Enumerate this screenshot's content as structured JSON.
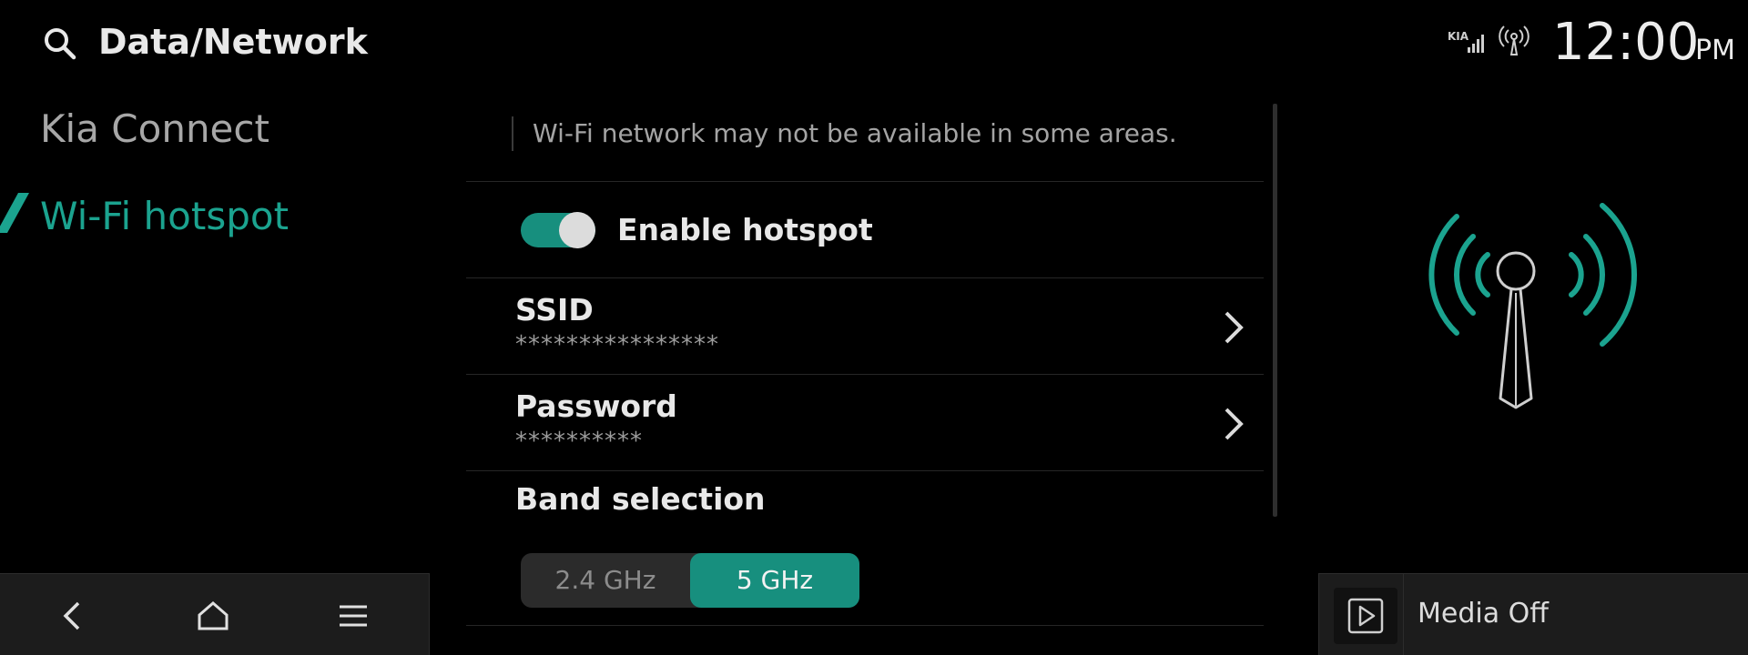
{
  "header": {
    "title": "Data/Network",
    "time": "12:00",
    "ampm": "PM",
    "status_icons": [
      "kia-signal-icon",
      "hotspot-broadcast-icon"
    ]
  },
  "sidebar": {
    "items": [
      {
        "label": "Kia Connect",
        "selected": false
      },
      {
        "label": "Wi-Fi hotspot",
        "selected": true
      }
    ]
  },
  "content": {
    "notice": "Wi-Fi network may not be available in some areas.",
    "hotspot": {
      "label": "Enable hotspot",
      "enabled": true
    },
    "ssid": {
      "label": "SSID",
      "value": "****************"
    },
    "password": {
      "label": "Password",
      "value": "**********"
    },
    "band": {
      "label": "Band selection",
      "options": [
        "2.4 GHz",
        "5 GHz"
      ],
      "selected": "5 GHz"
    }
  },
  "bottom_nav": {
    "icons": [
      "back-icon",
      "home-icon",
      "menu-icon"
    ]
  },
  "media": {
    "label": "Media Off",
    "icon": "play-icon"
  },
  "colors": {
    "accent": "#1ba38f",
    "toggle_on": "#178f7e",
    "background": "#000000",
    "panel": "#1c1c1c"
  }
}
